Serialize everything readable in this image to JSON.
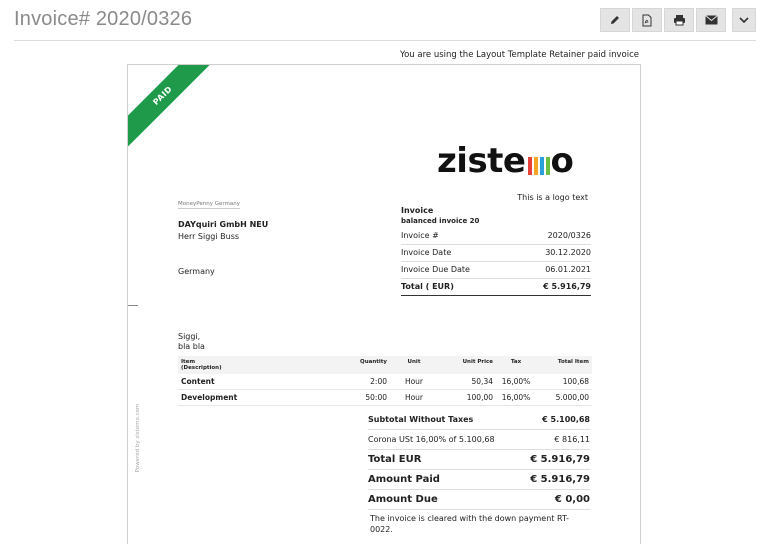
{
  "header": {
    "title": "Invoice# 2020/0326",
    "buttons": [
      {
        "icon": "pencil-icon",
        "label": "Edit"
      },
      {
        "icon": "pdf-icon",
        "label": "PDF"
      },
      {
        "icon": "print-icon",
        "label": "Print"
      },
      {
        "icon": "envelope-icon",
        "label": "Email"
      },
      {
        "icon": "chevron-down-icon",
        "label": "More"
      }
    ]
  },
  "template_note": "You are using the Layout Template Retainer paid invoice",
  "document": {
    "ribbon": "PAID",
    "logo": {
      "left": "ziste",
      "right": "o",
      "bar_colors": [
        "#e8423b",
        "#f5a623",
        "#2a9fd8",
        "#6bbf45"
      ]
    },
    "logo_text": "This is a logo text",
    "sender_line": "MoneyPenny Germany",
    "recipient": {
      "company": "DAYquiri GmbH NEU",
      "contact": "Herr Siggi Buss",
      "country": "Germany"
    },
    "invoice": {
      "heading": "Invoice",
      "subheading": "balanced invoice 20",
      "rows": [
        {
          "label": "Invoice #",
          "value": "2020/0326"
        },
        {
          "label": "Invoice Date",
          "value": "30.12.2020"
        },
        {
          "label": "Invoice Due Date",
          "value": "06.01.2021"
        },
        {
          "label": "Total ( EUR)",
          "value": "€ 5.916,79"
        }
      ]
    },
    "greeting": {
      "line1": "Siggi,",
      "line2": "bla bla"
    },
    "items_table": {
      "headers": {
        "item": "Item",
        "description": "(Description)",
        "quantity": "Quantity",
        "unit": "Unit",
        "unit_price": "Unit Price",
        "tax": "Tax",
        "total": "Total Item"
      },
      "rows": [
        {
          "item": "Content",
          "quantity": "2:00",
          "unit": "Hour",
          "unit_price": "50,34",
          "tax": "16,00%",
          "total": "100,68"
        },
        {
          "item": "Development",
          "quantity": "50:00",
          "unit": "Hour",
          "unit_price": "100,00",
          "tax": "16,00%",
          "total": "5.000,00"
        }
      ]
    },
    "powered_by": "Powered by zistemo.com",
    "totals": [
      {
        "label": "Subtotal Without Taxes",
        "value": "€ 5.100,68"
      },
      {
        "label": "Corona USt 16,00% of 5.100,68",
        "value": "€ 816,11"
      },
      {
        "label": "Total EUR",
        "value": "€ 5.916,79"
      },
      {
        "label": "Amount Paid",
        "value": "€ 5.916,79"
      },
      {
        "label": "Amount Due",
        "value": "€ 0,00"
      }
    ],
    "cleared_note": "The invoice is cleared with the down payment RT-0022."
  }
}
